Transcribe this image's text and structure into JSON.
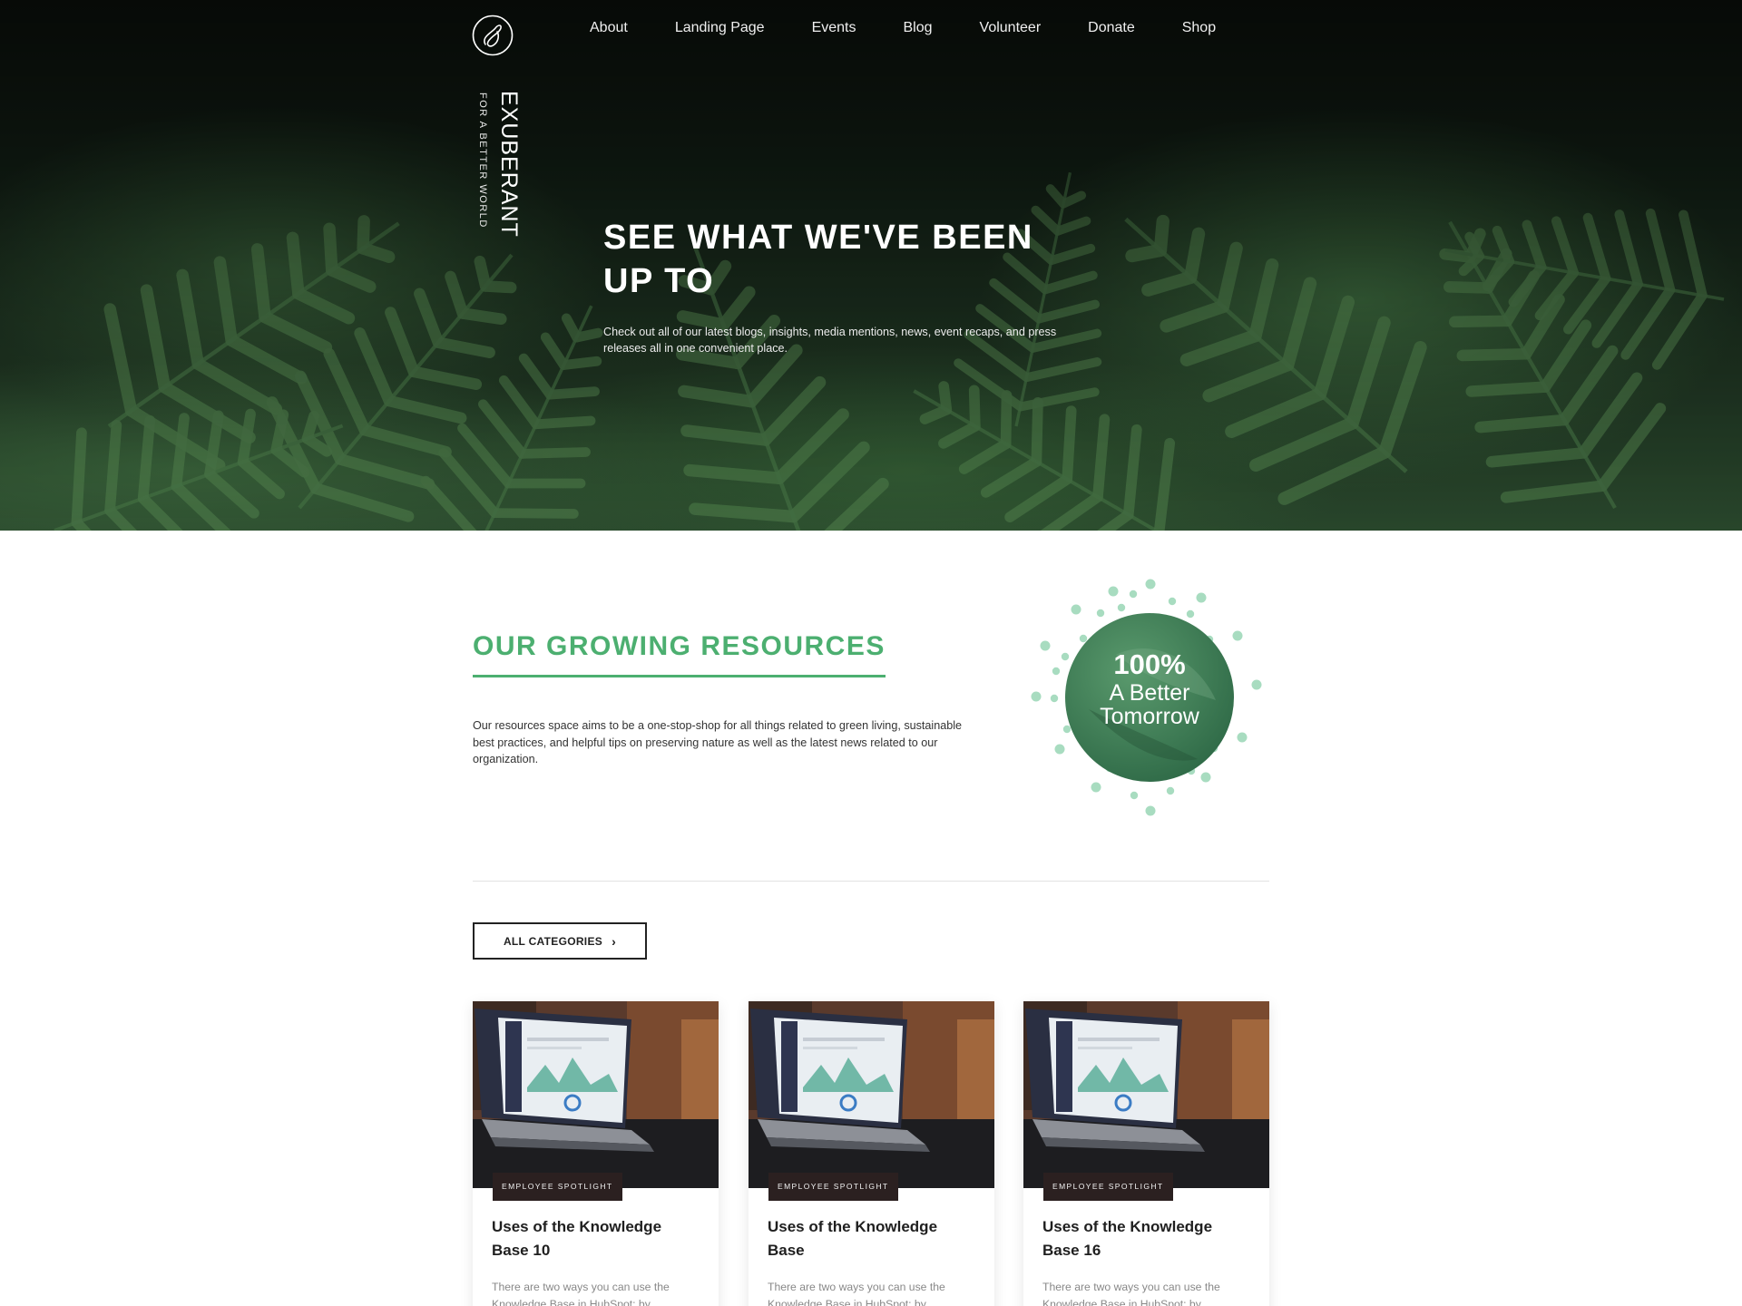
{
  "brand": {
    "name": "EXUBERANT",
    "tagline": "FOR A BETTER WORLD"
  },
  "nav": {
    "items": [
      {
        "label": "About"
      },
      {
        "label": "Landing Page"
      },
      {
        "label": "Events"
      },
      {
        "label": "Blog"
      },
      {
        "label": "Volunteer"
      },
      {
        "label": "Donate"
      },
      {
        "label": "Shop"
      }
    ]
  },
  "hero": {
    "title": "SEE WHAT WE'VE BEEN UP TO",
    "subtitle": "Check out all of our latest blogs, insights, media mentions, news, event recaps, and press releases all in one convenient place."
  },
  "resources": {
    "title": "OUR GROWING RESOURCES",
    "description": "Our resources space aims to be a one-stop-shop for all things related to green living, sustainable best practices, and helpful tips on preserving nature as well as the latest news related to our organization.",
    "badge": {
      "percent": "100%",
      "line1": "A Better",
      "line2": "Tomorrow"
    },
    "category_button": "ALL CATEGORIES"
  },
  "posts": [
    {
      "tag": "EMPLOYEE SPOTLIGHT",
      "title": "Uses of the Knowledge Base 10",
      "excerpt": "There are two ways you can use the Knowledge Base in HubSpot: by"
    },
    {
      "tag": "EMPLOYEE SPOTLIGHT",
      "title": "Uses of the Knowledge Base",
      "excerpt": "There are two ways you can use the Knowledge Base in HubSpot: by"
    },
    {
      "tag": "EMPLOYEE SPOTLIGHT",
      "title": "Uses of the Knowledge Base 16",
      "excerpt": "There are two ways you can use the Knowledge Base in HubSpot: by"
    }
  ],
  "colors": {
    "accent_green": "#4caf70",
    "badge_green": "#3f7d58",
    "dot_green": "#a8dcc0",
    "tag_background": "#2b2020"
  },
  "icons": {
    "logo": "leaf-loop-logo",
    "category_chevron": "chevron-right-icon"
  }
}
